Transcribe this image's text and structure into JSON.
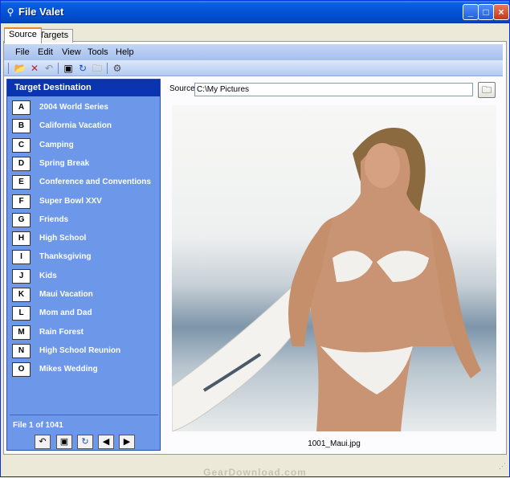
{
  "window": {
    "title": "File Valet"
  },
  "title_buttons": {
    "minimize": "_",
    "maximize": "□",
    "close": "×"
  },
  "tabs": [
    {
      "label": "Source"
    },
    {
      "label": "Targets"
    }
  ],
  "menu": [
    {
      "label": "File"
    },
    {
      "label": "Edit"
    },
    {
      "label": "View"
    },
    {
      "label": "Tools"
    },
    {
      "label": "Help"
    }
  ],
  "toolbar_icons": {
    "open": "📂",
    "delete": "✕",
    "undo": "↶",
    "copy": "▣",
    "refresh": "↻",
    "folder": "🗀",
    "settings": "⚙"
  },
  "left_panel": {
    "header": "Target Destination",
    "targets": [
      {
        "key": "A",
        "label": "2004 World Series"
      },
      {
        "key": "B",
        "label": "California Vacation"
      },
      {
        "key": "C",
        "label": "Camping"
      },
      {
        "key": "D",
        "label": "Spring Break"
      },
      {
        "key": "E",
        "label": "Conference and Conventions"
      },
      {
        "key": "F",
        "label": "Super Bowl XXV"
      },
      {
        "key": "G",
        "label": "Friends"
      },
      {
        "key": "H",
        "label": "High School"
      },
      {
        "key": "I",
        "label": "Thanksgiving"
      },
      {
        "key": "J",
        "label": "Kids"
      },
      {
        "key": "K",
        "label": "Maui Vacation"
      },
      {
        "key": "L",
        "label": "Mom and Dad"
      },
      {
        "key": "M",
        "label": "Rain Forest"
      },
      {
        "key": "N",
        "label": "High School Reunion"
      },
      {
        "key": "O",
        "label": "Mikes Wedding"
      }
    ],
    "file_count": "File 1 of 1041",
    "nav": {
      "undo": "↶",
      "copy": "▣",
      "refresh": "↻",
      "prev": "◀",
      "next": "▶"
    }
  },
  "source": {
    "label": "Source:",
    "value": "C:\\My Pictures",
    "folder_icon": "🗀"
  },
  "preview": {
    "file_name": "1001_Maui.jpg"
  },
  "watermark": "GearDownload.com",
  "colors": {
    "title_bar": "#0453d6",
    "panel_blue": "#6d97e9",
    "panel_header": "#0b35b0"
  }
}
